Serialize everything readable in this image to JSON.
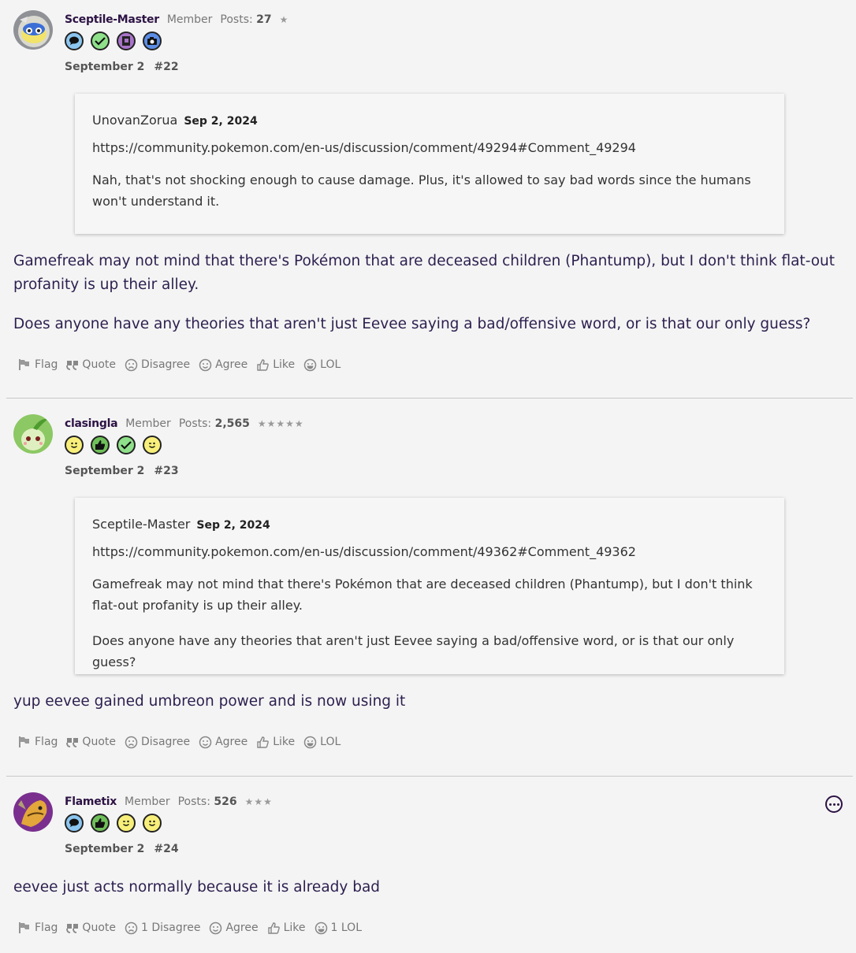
{
  "posts": [
    {
      "author": "Sceptile-Master",
      "role": "Member",
      "posts_label": "Posts:",
      "posts_count": "27",
      "stars": "★",
      "date": "September 2",
      "number": "#22",
      "badges": [
        "speech-bubble-badge",
        "checkmark-badge",
        "notebook-badge",
        "camera-badge"
      ],
      "quote": {
        "author": "UnovanZorua",
        "date": "Sep 2, 2024",
        "link": "https://community.pokemon.com/en-us/discussion/comment/49294#Comment_49294",
        "paragraphs": [
          "Nah, that's not shocking enough to cause damage. Plus, it's allowed to say bad words since the humans won't understand it."
        ]
      },
      "body": [
        "Gamefreak may not mind that there's Pokémon that are deceased children (Phantump), but I don't think flat-out profanity is up their alley.",
        "Does anyone have any theories that aren't just Eevee saying a bad/offensive word, or is that our only guess?"
      ],
      "actions": {
        "flag": "Flag",
        "quote": "Quote",
        "disagree": "Disagree",
        "agree": "Agree",
        "like": "Like",
        "lol": "LOL"
      }
    },
    {
      "author": "clasingla",
      "role": "Member",
      "posts_label": "Posts:",
      "posts_count": "2,565",
      "stars": "★★★★★",
      "date": "September 2",
      "number": "#23",
      "badges": [
        "smiley-badge",
        "thumbs-up-badge",
        "checkmark-badge",
        "wink-badge"
      ],
      "quote": {
        "author": "Sceptile-Master",
        "date": "Sep 2, 2024",
        "link": "https://community.pokemon.com/en-us/discussion/comment/49362#Comment_49362",
        "paragraphs": [
          "Gamefreak may not mind that there's Pokémon that are deceased children (Phantump), but I don't think flat-out profanity is up their alley.",
          "Does anyone have any theories that aren't just Eevee saying a bad/offensive word, or is that our only guess?"
        ]
      },
      "body": [
        "yup eevee gained umbreon power and is now using it"
      ],
      "actions": {
        "flag": "Flag",
        "quote": "Quote",
        "disagree": "Disagree",
        "agree": "Agree",
        "like": "Like",
        "lol": "LOL"
      }
    },
    {
      "author": "Flametix",
      "role": "Member",
      "posts_label": "Posts:",
      "posts_count": "526",
      "stars": "★★★",
      "date": "September 2",
      "number": "#24",
      "badges": [
        "speech-bubble-badge",
        "thumbs-up-badge",
        "wink-badge",
        "smiley-badge"
      ],
      "body": [
        "eevee just acts normally because it is already bad"
      ],
      "actions": {
        "flag": "Flag",
        "quote": "Quote",
        "disagree": "1 Disagree",
        "agree": "Agree",
        "like": "Like",
        "lol": "1 LOL"
      }
    }
  ],
  "colors": {
    "background": "#f4f4f4",
    "text": "#2d1f4f",
    "muted": "#777777",
    "author": "#2d1345"
  }
}
